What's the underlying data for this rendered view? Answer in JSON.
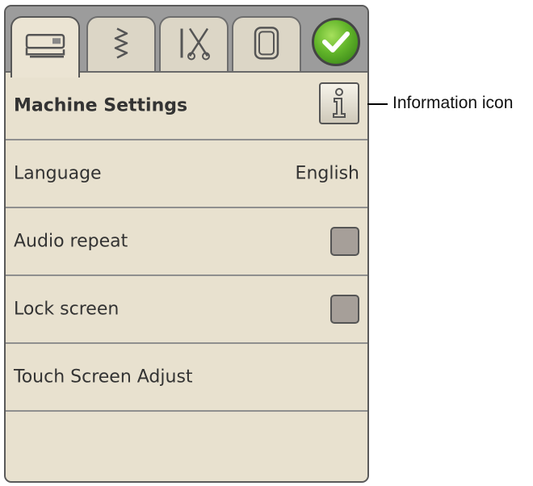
{
  "tabs": [
    {
      "icon": "sewing-machine-icon",
      "active": true
    },
    {
      "icon": "zigzag-stitch-icon",
      "active": false
    },
    {
      "icon": "needle-scissors-icon",
      "active": false
    },
    {
      "icon": "embroidery-hoop-icon",
      "active": false
    }
  ],
  "ok_button": {
    "icon": "checkmark-icon",
    "color": "#62b52a"
  },
  "header": {
    "title": "Machine Settings",
    "info_icon": "info-icon"
  },
  "rows": [
    {
      "label": "Language",
      "value": "English"
    },
    {
      "label": "Audio repeat",
      "checked": false
    },
    {
      "label": "Lock screen",
      "checked": false
    },
    {
      "label": "Touch Screen Adjust"
    }
  ],
  "callout": {
    "text": "Information icon"
  },
  "colors": {
    "panel": "#e8e1cf",
    "frame": "#9c9c9c",
    "checkbox": "#a69f99",
    "ok_green": "#62b52a"
  }
}
